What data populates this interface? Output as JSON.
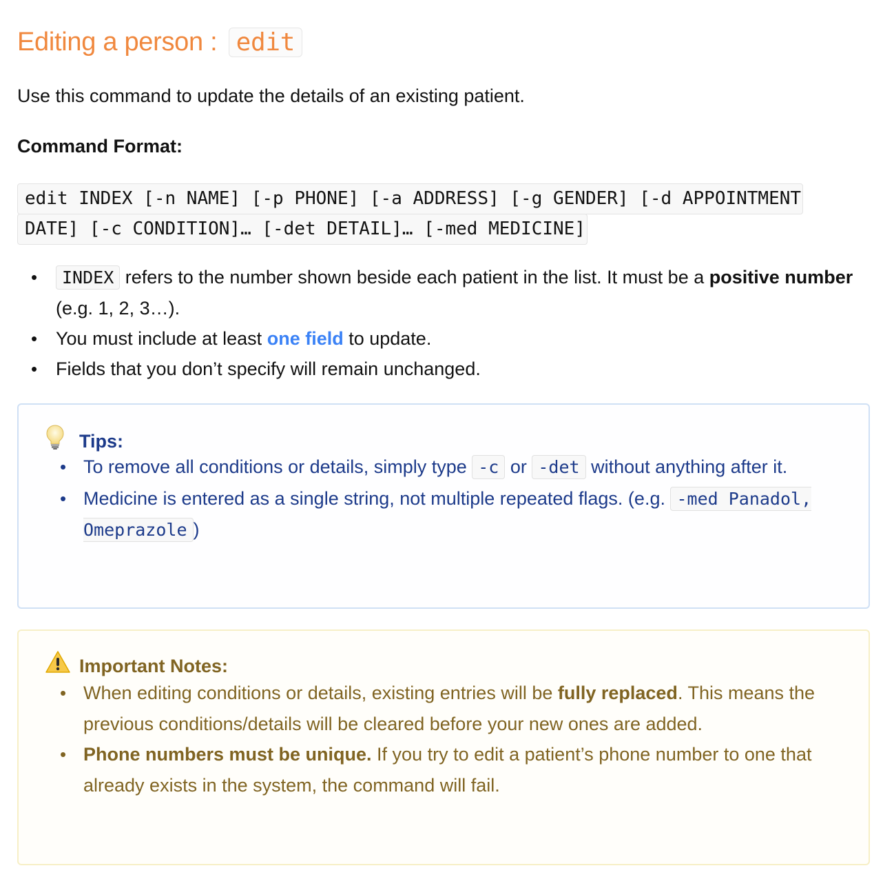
{
  "heading": {
    "text": "Editing a person :",
    "code": "edit"
  },
  "intro": "Use this command to update the details of an existing patient.",
  "format_label": "Command Format:",
  "format_code": "edit INDEX [-n NAME] [-p PHONE] [-a ADDRESS] [-g GENDER] [-d APPOINTMENT DATE] [-c CONDITION]… [-det DETAIL]… [-med MEDICINE]",
  "bullets": {
    "b1": {
      "code": "INDEX",
      "text1": " refers to the number shown beside each patient in the list. It must be a ",
      "bold": "positive number",
      "text2": " (e.g. 1, 2, 3…)."
    },
    "b2": {
      "text1": "You must include at least ",
      "link": "one field",
      "text2": " to update."
    },
    "b3": {
      "text": "Fields that you don’t specify will remain unchanged."
    }
  },
  "tips": {
    "icon": "lightbulb-icon",
    "title": "Tips:",
    "t1": {
      "text1": "To remove all conditions or details, simply type ",
      "code1": "-c",
      "text2": " or ",
      "code2": "-det",
      "text3": " without anything after it."
    },
    "t2": {
      "text1": "Medicine is entered as a single string, not multiple repeated flags. (e.g. ",
      "code": "-med Panadol, Omeprazole",
      "text2": ")"
    }
  },
  "notes": {
    "icon": "warning-icon",
    "title": "Important Notes:",
    "n1": {
      "text1": "When editing conditions or details, existing entries will be ",
      "bold": "fully replaced",
      "text2": ". This means the previous conditions/details will be cleared before your new ones are added."
    },
    "n2": {
      "bold": "Phone numbers must be unique.",
      "text": " If you try to edit a patient’s phone number to one that already exists in the system, the command will fail."
    }
  },
  "colors": {
    "heading": "#f0883e",
    "link": "#3b82f6",
    "tips_text": "#1c3a8a",
    "tips_border": "#cfe0f5",
    "notes_text": "#806422",
    "notes_border": "#f7efc6"
  }
}
